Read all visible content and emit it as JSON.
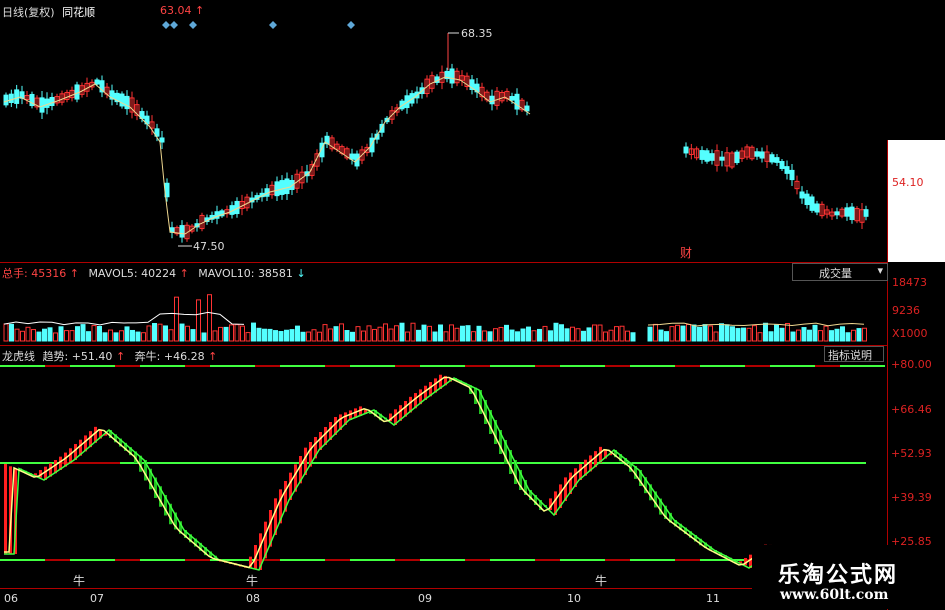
{
  "top_panel": {
    "period_label": "日线(复权)",
    "stock_name": "同花顺",
    "price_label": "63.04",
    "price_arrow": "↑",
    "high_label": "68.35",
    "low_label": "47.50",
    "finance_marker": "财",
    "axis_tick": "54.10"
  },
  "volume_panel": {
    "total_label": "总手:",
    "total_value": "45316",
    "total_arrow": "↑",
    "mavol5_label": "MAVOL5:",
    "mavol5_value": "40224",
    "mavol5_arrow": "↑",
    "mavol10_label": "MAVOL10:",
    "mavol10_value": "38581",
    "mavol10_arrow": "↓",
    "dropdown_label": "成交量",
    "axis_tick_1": "18473",
    "axis_tick_2": "9236",
    "axis_unit": "X1000"
  },
  "indicator_panel": {
    "name": "龙虎线",
    "trend_label": "趋势:",
    "trend_value": "+51.40",
    "trend_arrow": "↑",
    "bull_label": "奔牛:",
    "bull_value": "+46.28",
    "bull_arrow": "↑",
    "help_button": "指标说明",
    "axis_ticks": [
      "+80.00",
      "+66.46",
      "+52.93",
      "+39.39",
      "+25.85"
    ],
    "bull_markers": [
      "牛",
      "牛",
      "牛"
    ]
  },
  "x_axis": {
    "labels": [
      "06",
      "07",
      "08",
      "09",
      "10",
      "11"
    ]
  },
  "watermark": {
    "line1": "乐淘公式网",
    "line2": "www.60lt.com"
  },
  "colors": {
    "up": "#ff3333",
    "down": "#54ffff",
    "grid_red": "#b00000",
    "line_green": "#40ff40",
    "line_yellow": "#ffff88",
    "bar_green": "#20c020",
    "bar_red": "#ff2020"
  }
}
